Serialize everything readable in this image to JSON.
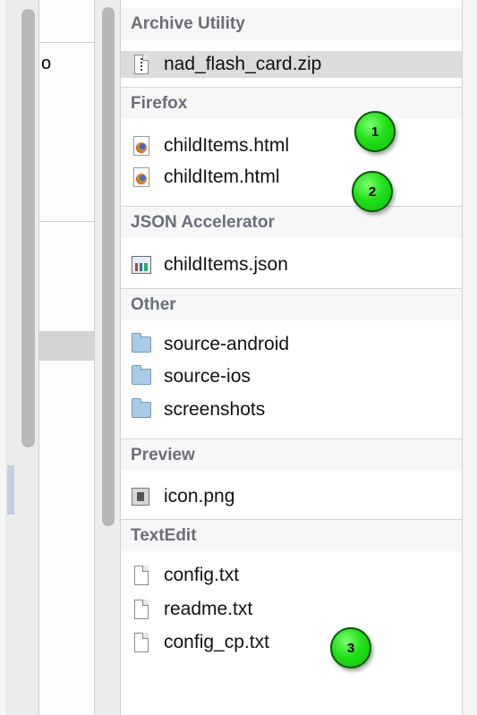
{
  "sections": [
    {
      "header": "Archive Utility",
      "items": [
        {
          "label": "nad_flash_card.zip",
          "icon": "zip-file-icon",
          "selected": true
        }
      ]
    },
    {
      "header": "Firefox",
      "items": [
        {
          "label": "childItems.html",
          "icon": "firefox-document-icon"
        },
        {
          "label": "childItem.html",
          "icon": "firefox-document-icon"
        }
      ]
    },
    {
      "header": "JSON Accelerator",
      "items": [
        {
          "label": "childItems.json",
          "icon": "json-accelerator-document-icon"
        }
      ]
    },
    {
      "header": "Other",
      "items": [
        {
          "label": "source-android",
          "icon": "folder-icon"
        },
        {
          "label": "source-ios",
          "icon": "folder-icon"
        },
        {
          "label": "screenshots",
          "icon": "folder-icon"
        }
      ]
    },
    {
      "header": "Preview",
      "items": [
        {
          "label": "icon.png",
          "icon": "image-file-icon"
        }
      ]
    },
    {
      "header": "TextEdit",
      "items": [
        {
          "label": "config.txt",
          "icon": "text-document-icon"
        },
        {
          "label": "readme.txt",
          "icon": "text-document-icon"
        },
        {
          "label": "config_cp.txt",
          "icon": "text-document-icon"
        }
      ]
    }
  ],
  "callouts": [
    "1",
    "2",
    "3"
  ],
  "left_pane_glyph": "o",
  "colors": {
    "callout_green": "#22e01a",
    "header_text": "#6b6f78",
    "selected_row": "#dcdcdc"
  }
}
